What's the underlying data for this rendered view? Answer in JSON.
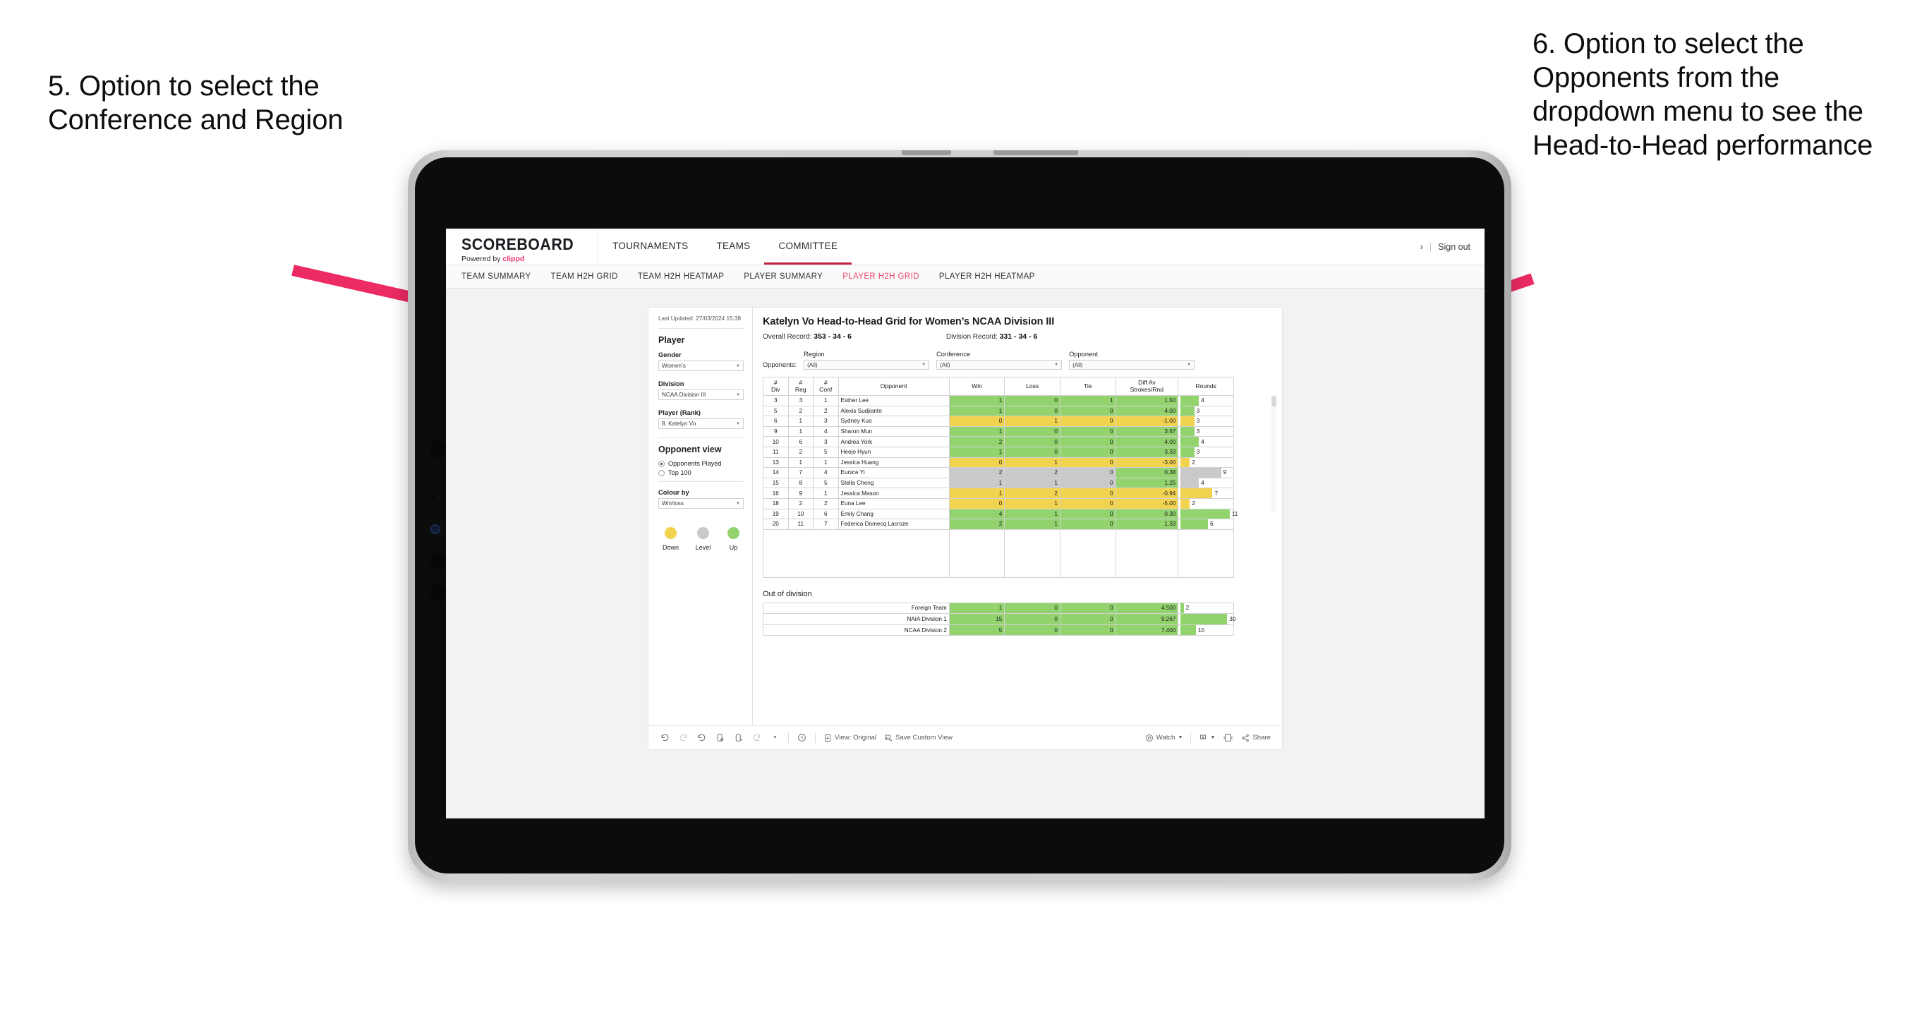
{
  "annotations": {
    "left": "5. Option to select the Conference and Region",
    "right": "6. Option to select the Opponents from the dropdown menu to see the Head-to-Head performance",
    "arrow_color": "#ec2a63"
  },
  "app": {
    "brand": {
      "title": "SCOREBOARD",
      "powered_prefix": "Powered by ",
      "powered_name": "clippd"
    },
    "topnav": [
      {
        "label": "TOURNAMENTS",
        "active": false
      },
      {
        "label": "TEAMS",
        "active": false
      },
      {
        "label": "COMMITTEE",
        "active": true
      }
    ],
    "topnav_right": {
      "chevron": "›",
      "separator": "|",
      "sign_out": "Sign out"
    },
    "subnav": [
      {
        "label": "TEAM SUMMARY",
        "active": false
      },
      {
        "label": "TEAM H2H GRID",
        "active": false
      },
      {
        "label": "TEAM H2H HEATMAP",
        "active": false
      },
      {
        "label": "PLAYER SUMMARY",
        "active": false
      },
      {
        "label": "PLAYER H2H GRID",
        "active": true
      },
      {
        "label": "PLAYER H2H HEATMAP",
        "active": false
      }
    ],
    "accent_red": "#e8486f",
    "accent_underline": "#c0213f"
  },
  "sidebar": {
    "last_updated": "Last Updated: 27/03/2024 15:38",
    "player_heading": "Player",
    "fields": [
      {
        "label": "Gender",
        "value": "Women’s"
      },
      {
        "label": "Division",
        "value": "NCAA Division III"
      },
      {
        "label": "Player (Rank)",
        "value": "8. Katelyn Vo"
      }
    ],
    "opponent_view": {
      "heading": "Opponent view",
      "options": [
        {
          "label": "Opponents Played",
          "selected": true
        },
        {
          "label": "Top 100",
          "selected": false
        }
      ]
    },
    "colour_by": {
      "label": "Colour by",
      "value": "Win/loss"
    },
    "legend": [
      {
        "label": "Down",
        "color": "#f2d34f"
      },
      {
        "label": "Level",
        "color": "#c9c9c9"
      },
      {
        "label": "Up",
        "color": "#92d36e"
      }
    ]
  },
  "main": {
    "title": "Katelyn Vo Head-to-Head Grid for Women’s NCAA Division III",
    "overall_record_label": "Overall Record: ",
    "overall_record_value": "353 - 34 - 6",
    "division_record_label": "Division Record: ",
    "division_record_value": "331 - 34 - 6",
    "opponents_label": "Opponents:",
    "filters": [
      {
        "label": "Region",
        "value": "(All)"
      },
      {
        "label": "Conference",
        "value": "(All)"
      },
      {
        "label": "Opponent",
        "value": "(All)"
      }
    ],
    "out_of_division_title": "Out of division"
  },
  "chart_data": {
    "type": "table",
    "title": "Katelyn Vo Head-to-Head Grid for Women’s NCAA Division III",
    "columns": [
      "# Div",
      "# Reg",
      "# Conf",
      "Opponent",
      "Win",
      "Loss",
      "Tie",
      "Diff Av Strokes/Rnd",
      "Rounds"
    ],
    "rows": [
      {
        "div": "3",
        "reg": "3",
        "conf": "1",
        "opponent": "Esther Lee",
        "win": "1",
        "loss": "0",
        "tie": "1",
        "diff": "1.50",
        "rounds": "4",
        "tone": "g",
        "bar_pct": 36
      },
      {
        "div": "5",
        "reg": "2",
        "conf": "2",
        "opponent": "Alexis Sudjianto",
        "win": "1",
        "loss": "0",
        "tie": "0",
        "diff": "4.00",
        "rounds": "3",
        "tone": "g",
        "bar_pct": 27
      },
      {
        "div": "6",
        "reg": "1",
        "conf": "3",
        "opponent": "Sydney Kuo",
        "win": "0",
        "loss": "1",
        "tie": "0",
        "diff": "-1.00",
        "rounds": "3",
        "tone": "y",
        "bar_pct": 27
      },
      {
        "div": "9",
        "reg": "1",
        "conf": "4",
        "opponent": "Sharon Mun",
        "win": "1",
        "loss": "0",
        "tie": "0",
        "diff": "3.67",
        "rounds": "3",
        "tone": "g",
        "bar_pct": 27
      },
      {
        "div": "10",
        "reg": "6",
        "conf": "3",
        "opponent": "Andrea York",
        "win": "2",
        "loss": "0",
        "tie": "0",
        "diff": "4.00",
        "rounds": "4",
        "tone": "g",
        "bar_pct": 36
      },
      {
        "div": "11",
        "reg": "2",
        "conf": "5",
        "opponent": "Heejo Hyun",
        "win": "1",
        "loss": "0",
        "tie": "0",
        "diff": "3.33",
        "rounds": "3",
        "tone": "g",
        "bar_pct": 27
      },
      {
        "div": "13",
        "reg": "1",
        "conf": "1",
        "opponent": "Jessica Huang",
        "win": "0",
        "loss": "1",
        "tie": "0",
        "diff": "-3.00",
        "rounds": "2",
        "tone": "y",
        "bar_pct": 18
      },
      {
        "div": "14",
        "reg": "7",
        "conf": "4",
        "opponent": "Eunice Yi",
        "win": "2",
        "loss": "2",
        "tie": "0",
        "diff": "0.38",
        "rounds": "9",
        "tone": "gy",
        "bar_pct": 80,
        "diff_tone": "g"
      },
      {
        "div": "15",
        "reg": "8",
        "conf": "5",
        "opponent": "Stella Cheng",
        "win": "1",
        "loss": "1",
        "tie": "0",
        "diff": "1.25",
        "rounds": "4",
        "tone": "gy",
        "bar_pct": 36,
        "diff_tone": "g"
      },
      {
        "div": "16",
        "reg": "9",
        "conf": "1",
        "opponent": "Jessica Mason",
        "win": "1",
        "loss": "2",
        "tie": "0",
        "diff": "-0.94",
        "rounds": "7",
        "tone": "y",
        "bar_pct": 63
      },
      {
        "div": "18",
        "reg": "2",
        "conf": "2",
        "opponent": "Euna Lee",
        "win": "0",
        "loss": "1",
        "tie": "0",
        "diff": "-5.00",
        "rounds": "2",
        "tone": "y",
        "bar_pct": 18
      },
      {
        "div": "19",
        "reg": "10",
        "conf": "6",
        "opponent": "Emily Chang",
        "win": "4",
        "loss": "1",
        "tie": "0",
        "diff": "0.30",
        "rounds": "11",
        "tone": "g",
        "bar_pct": 97
      },
      {
        "div": "20",
        "reg": "11",
        "conf": "7",
        "opponent": "Federica Domecq Lacroze",
        "win": "2",
        "loss": "1",
        "tie": "0",
        "diff": "1.33",
        "rounds": "6",
        "tone": "g",
        "bar_pct": 54
      }
    ],
    "out_of_division": {
      "title": "Out of division",
      "rows": [
        {
          "name": "Foreign Team",
          "win": "1",
          "loss": "0",
          "tie": "0",
          "diff": "4.500",
          "rounds": "2",
          "tone": "g",
          "bar_pct": 6
        },
        {
          "name": "NAIA Division 1",
          "win": "15",
          "loss": "0",
          "tie": "0",
          "diff": "9.267",
          "rounds": "30",
          "tone": "g",
          "bar_pct": 92
        },
        {
          "name": "NCAA Division 2",
          "win": "5",
          "loss": "0",
          "tie": "0",
          "diff": "7.400",
          "rounds": "10",
          "tone": "g",
          "bar_pct": 30
        }
      ]
    },
    "colors": {
      "green": "#92d36e",
      "yellow": "#f2d34f",
      "grey": "#c9c9c9"
    }
  },
  "toolbar": {
    "icons": [
      "undo-icon",
      "redo-icon",
      "revert-icon",
      "refresh-data-icon",
      "pause-refresh-icon",
      "reset-icon",
      "dropdown-caret-icon",
      "clock-icon"
    ],
    "view_original": "View: Original",
    "save_custom_view": "Save Custom View",
    "watch": "Watch",
    "share": "Share"
  }
}
